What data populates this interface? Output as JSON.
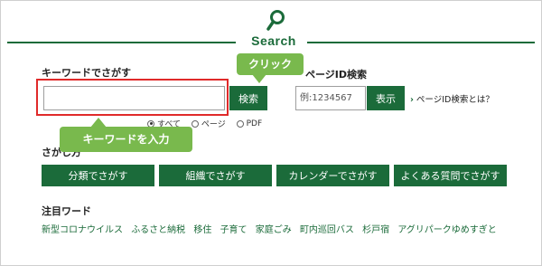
{
  "header": {
    "title": "Search"
  },
  "keyword_search": {
    "label": "キーワードでさがす",
    "input_value": "",
    "submit_label": "検索",
    "scope_options": [
      {
        "label": "すべて",
        "selected": true
      },
      {
        "label": "ページ",
        "selected": false
      },
      {
        "label": "PDF",
        "selected": false
      }
    ]
  },
  "page_id_search": {
    "label": "ページID検索",
    "placeholder": "例:1234567",
    "submit_label": "表示",
    "help_link": "ページID検索とは？"
  },
  "browse": {
    "label": "さがし方",
    "buttons": [
      "分類でさがす",
      "組織でさがす",
      "カレンダーでさがす",
      "よくある質問でさがす"
    ]
  },
  "attention": {
    "label": "注目ワード",
    "links": [
      "新型コロナウイルス",
      "ふるさと納税",
      "移住",
      "子育て",
      "家庭ごみ",
      "町内巡回バス",
      "杉戸宿",
      "アグリパークゆめすぎと"
    ]
  },
  "callouts": {
    "click": "クリック",
    "enter_keyword": "キーワードを入力"
  },
  "colors": {
    "brand_green": "#1b6b3a",
    "callout_green": "#79b94d",
    "highlight_red": "#e02a2a"
  }
}
